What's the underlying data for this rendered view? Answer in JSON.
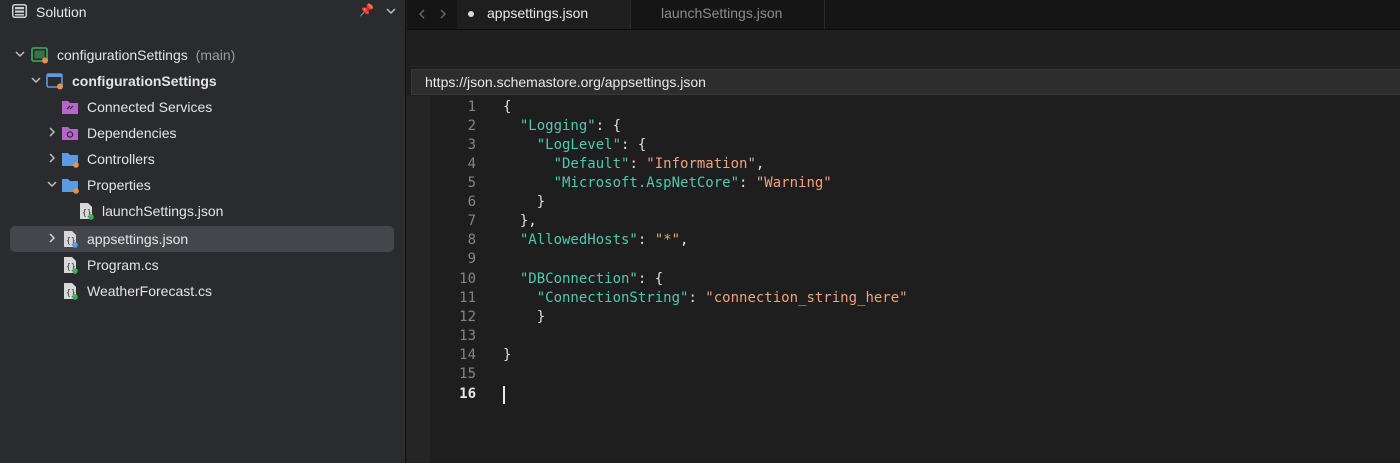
{
  "sidebar": {
    "title": "Solution",
    "items": [
      {
        "label": "configurationSettings",
        "suffix": "(main)"
      },
      {
        "label": "configurationSettings"
      },
      {
        "label": "Connected Services"
      },
      {
        "label": "Dependencies"
      },
      {
        "label": "Controllers"
      },
      {
        "label": "Properties"
      },
      {
        "label": "launchSettings.json"
      },
      {
        "label": "appsettings.json"
      },
      {
        "label": "Program.cs"
      },
      {
        "label": "WeatherForecast.cs"
      }
    ]
  },
  "editor": {
    "tabs": [
      {
        "label": "appsettings.json",
        "active": true
      },
      {
        "label": "launchSettings.json",
        "active": false
      }
    ],
    "schema_url": "https://json.schemastore.org/appsettings.json",
    "line_numbers": [
      "1",
      "2",
      "3",
      "4",
      "5",
      "6",
      "7",
      "8",
      "9",
      "10",
      "11",
      "12",
      "13",
      "14",
      "15",
      "16"
    ],
    "current_line": "16",
    "code": {
      "l1_open": "{",
      "l2_key": "\"Logging\"",
      "l2_rest": ": {",
      "l3_key": "\"LogLevel\"",
      "l3_rest": ": {",
      "l4_key": "\"Default\"",
      "l4_sep": ": ",
      "l4_val": "\"Information\"",
      "l4_end": ",",
      "l5_key": "\"Microsoft.AspNetCore\"",
      "l5_sep": ": ",
      "l5_val": "\"Warning\"",
      "l6": "}",
      "l7": "},",
      "l8_key": "\"AllowedHosts\"",
      "l8_sep": ": ",
      "l8_val": "\"*\"",
      "l8_end": ",",
      "l10_key": "\"DBConnection\"",
      "l10_rest": ": {",
      "l11_key": "\"ConnectionString\"",
      "l11_sep": ": ",
      "l11_val": "\"connection_string_here\"",
      "l12": "}",
      "l14": "}"
    }
  },
  "colors": {
    "json_key": "#4ec9b0",
    "json_string": "#f0a37d",
    "selection": "#45464b",
    "folder": "#5d9be0",
    "badge_orange": "#e8914a",
    "badge_green": "#3fae5a"
  },
  "icons": [
    "panel-icon",
    "pin-icon",
    "chevron-down-icon",
    "chevron-right-icon",
    "chevron-left-icon",
    "solution-icon",
    "project-icon",
    "connected-services-icon",
    "dependencies-icon",
    "folder-icon",
    "json-file-icon",
    "csharp-file-icon"
  ]
}
